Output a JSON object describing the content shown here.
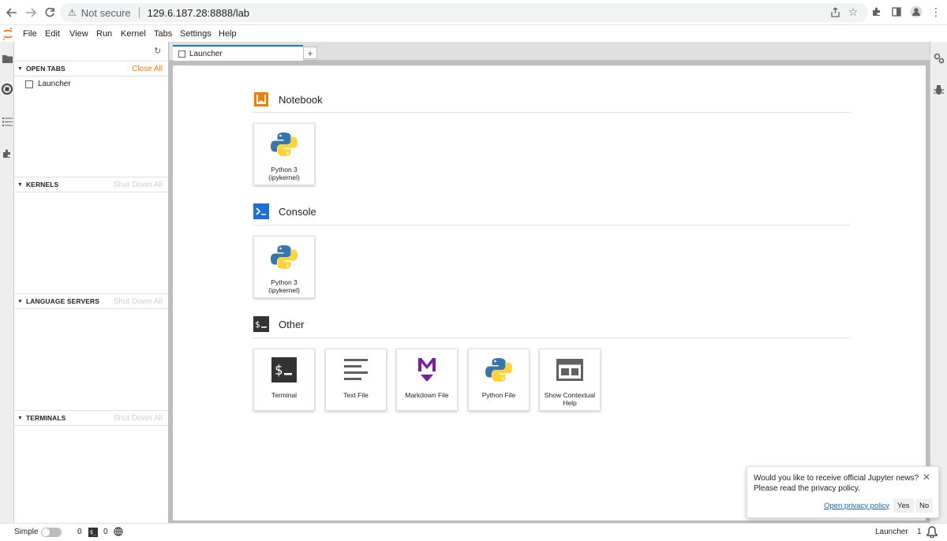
{
  "browser": {
    "security_label": "Not secure",
    "url": "129.6.187.28:8888/lab"
  },
  "menu": {
    "items": [
      "File",
      "Edit",
      "View",
      "Run",
      "Kernel",
      "Tabs",
      "Settings",
      "Help"
    ]
  },
  "sidebar": {
    "open_tabs": {
      "title": "OPEN TABS",
      "action": "Close All",
      "items": [
        "Launcher"
      ]
    },
    "kernels": {
      "title": "KERNELS",
      "action": "Shut Down All"
    },
    "language_servers": {
      "title": "LANGUAGE SERVERS",
      "action": "Shut Down All"
    },
    "terminals": {
      "title": "TERMINALS",
      "action": "Shut Down All"
    }
  },
  "tabs": {
    "active_label": "Launcher",
    "add_label": "+"
  },
  "launcher": {
    "notebook": {
      "title": "Notebook",
      "cards": [
        {
          "label1": "Python 3",
          "label2": "(ipykernel)"
        }
      ]
    },
    "console": {
      "title": "Console",
      "cards": [
        {
          "label1": "Python 3",
          "label2": "(ipykernel)"
        }
      ]
    },
    "other": {
      "title": "Other",
      "cards": [
        {
          "label1": "Terminal",
          "label2": ""
        },
        {
          "label1": "Text File",
          "label2": ""
        },
        {
          "label1": "Markdown File",
          "label2": ""
        },
        {
          "label1": "Python File",
          "label2": ""
        },
        {
          "label1": "Show Contextual",
          "label2": "Help"
        }
      ]
    }
  },
  "statusbar": {
    "mode_label": "Simple",
    "kernels_count": "0",
    "terminals_count": "0",
    "right_label": "Launcher",
    "notifications_count": "1"
  },
  "toast": {
    "line1": "Would you like to receive official Jupyter news?",
    "line2": "Please read the privacy policy.",
    "link_label": "Open privacy policy",
    "yes_label": "Yes",
    "no_label": "No",
    "close_label": "✕"
  },
  "colors": {
    "accent": "#f57c00",
    "tab_accent": "#1976d2",
    "console_blue": "#1e6fd6",
    "markdown_purple": "#7b1fa2"
  }
}
